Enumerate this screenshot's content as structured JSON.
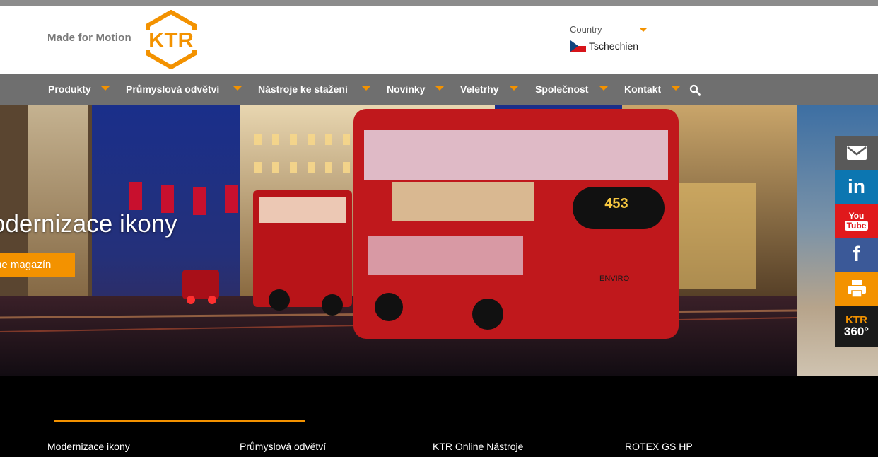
{
  "header": {
    "tagline": "Made for Motion",
    "logo_text": "KTR",
    "country_label": "Country",
    "country_value": "Tschechien"
  },
  "nav": {
    "items": [
      {
        "label": "Produkty"
      },
      {
        "label": "Průmyslová odvětví"
      },
      {
        "label": "Nástroje ke stažení"
      },
      {
        "label": "Novinky"
      },
      {
        "label": "Veletrhy"
      },
      {
        "label": "Společnost"
      },
      {
        "label": "Kontakt"
      }
    ],
    "search_icon": "search-icon"
  },
  "hero": {
    "title": "odernizace ikony",
    "button_label": "ne magazín",
    "bus_route": "453",
    "bus_brand": "ENVIRO"
  },
  "social": {
    "youtube_top": "You",
    "youtube_bottom": "Tube",
    "linkedin": "in",
    "facebook": "f",
    "ktr360_top": "KTR",
    "ktr360_bottom": "360°",
    "icons": [
      "mail-icon",
      "linkedin-icon",
      "youtube-icon",
      "facebook-icon",
      "print-icon",
      "ktr360-icon"
    ]
  },
  "footer": {
    "links": [
      {
        "label": "Modernizace ikony"
      },
      {
        "label": "Průmyslová odvětví"
      },
      {
        "label": "KTR Online Nástroje"
      },
      {
        "label": "ROTEX GS HP"
      }
    ]
  },
  "colors": {
    "accent": "#f39200",
    "nav_bg": "#6f6f6f",
    "topbar": "#8c8c8c",
    "footer_bg": "#000000",
    "linkedin": "#0c76b1",
    "youtube": "#e0191c",
    "facebook": "#3b5998"
  }
}
